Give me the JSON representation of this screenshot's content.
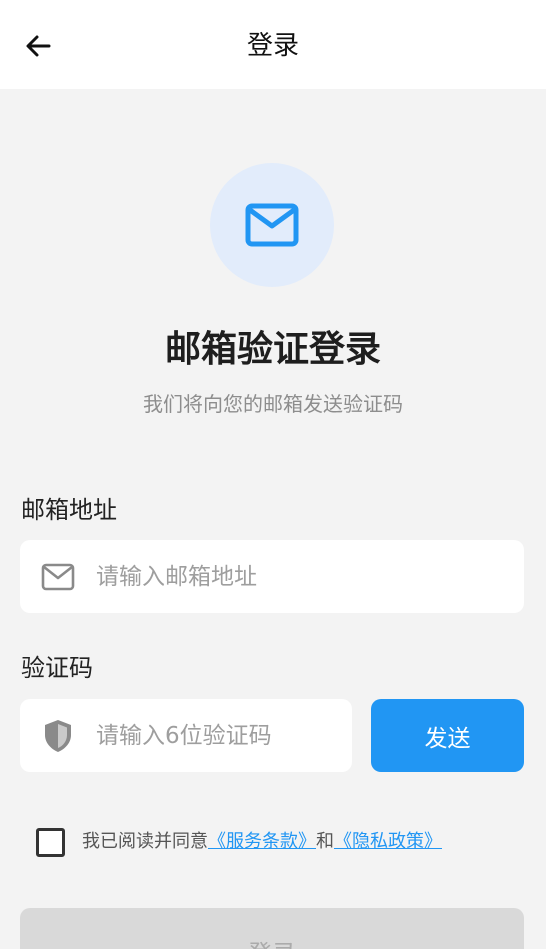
{
  "header": {
    "back_icon": "arrow-left-icon",
    "title": "登录"
  },
  "hero": {
    "icon": "mail-icon",
    "title": "邮箱验证登录",
    "subtitle": "我们将向您的邮箱发送验证码"
  },
  "email": {
    "label": "邮箱地址",
    "icon": "mail-outline-icon",
    "placeholder": "请输入邮箱地址",
    "value": ""
  },
  "code": {
    "label": "验证码",
    "icon": "shield-icon",
    "placeholder": "请输入6位验证码",
    "value": "",
    "send_label": "发送"
  },
  "agreement": {
    "checked": false,
    "prefix": "我已阅读并同意",
    "terms_link": "《服务条款》",
    "joiner": "和",
    "privacy_link": "《隐私政策》"
  },
  "login_button": {
    "label": "登录",
    "enabled": false
  },
  "colors": {
    "accent": "#2196f3",
    "hero_circle": "#e2ecfb",
    "background": "#f3f3f3",
    "disabled_button": "#d9d9d9"
  }
}
